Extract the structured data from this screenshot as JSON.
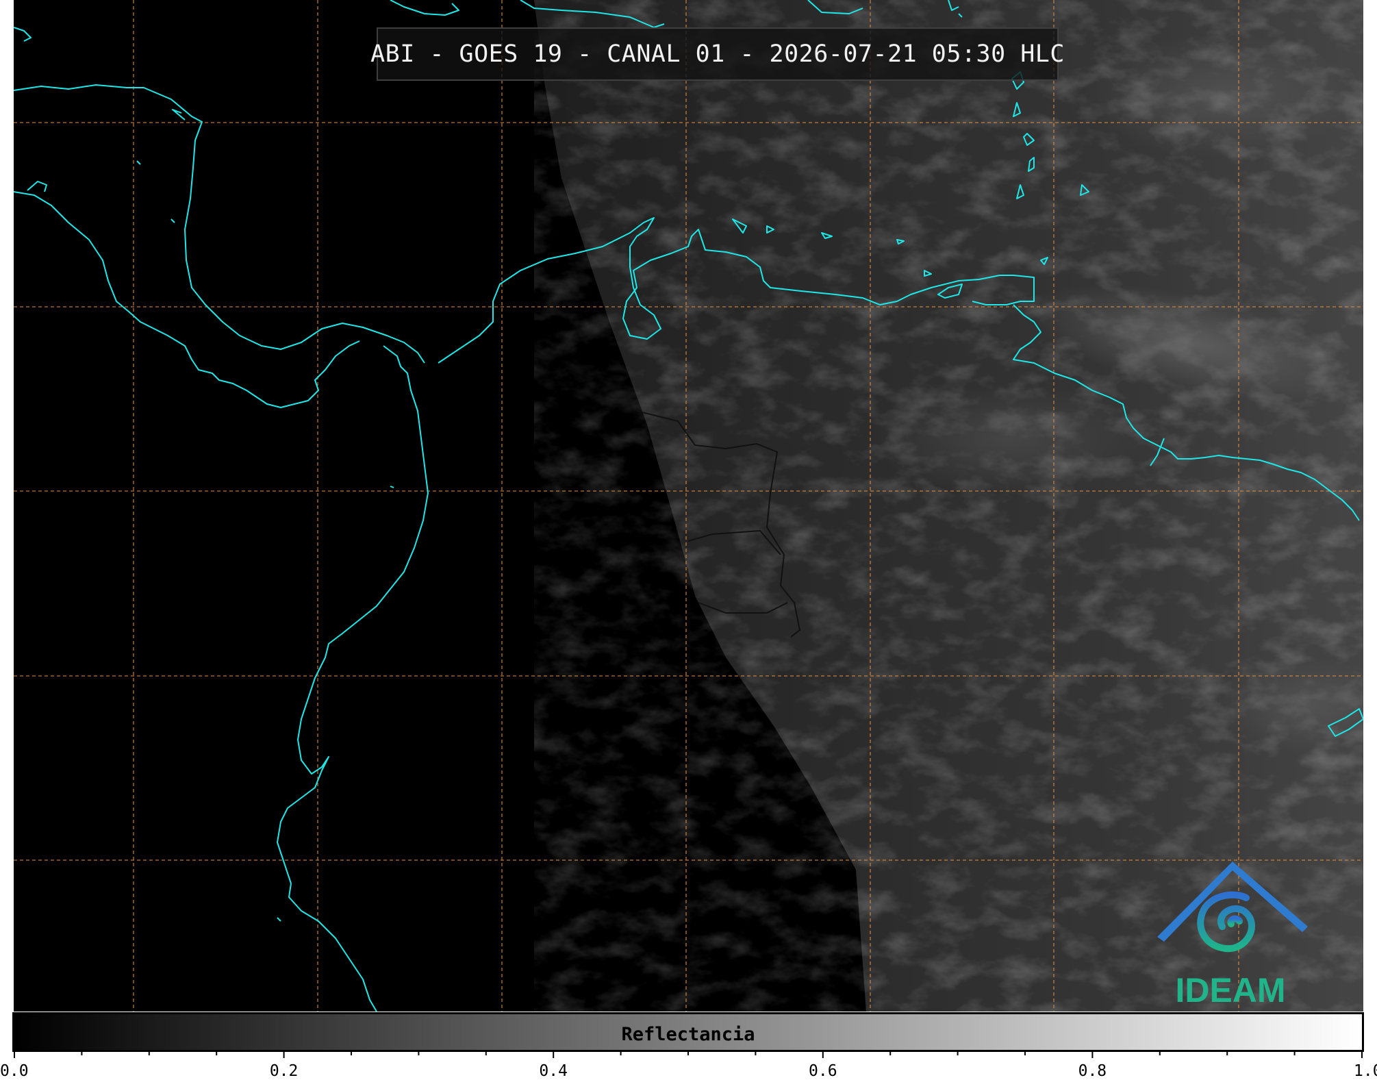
{
  "title": "ABI - GOES 19 - CANAL 01 - 2026-07-21 05:30 HLC",
  "colorbar": {
    "label": "Reflectancia",
    "min": 0.0,
    "max": 1.0,
    "tick_labels": [
      "0.0",
      "0.2",
      "0.4",
      "0.6",
      "0.8",
      "1.0"
    ],
    "minor_tick_step": 0.05,
    "colormap": [
      "#000000",
      "#ffffff"
    ]
  },
  "logo": {
    "text": "IDEAM"
  },
  "colors": {
    "coastline": "#1fe7e7",
    "gridline": "#e08a3c",
    "border": "#111111",
    "logo_blue": "#2e7bd0",
    "logo_green": "#21b38a"
  },
  "icons": [
    "ideam-logo-icon"
  ]
}
